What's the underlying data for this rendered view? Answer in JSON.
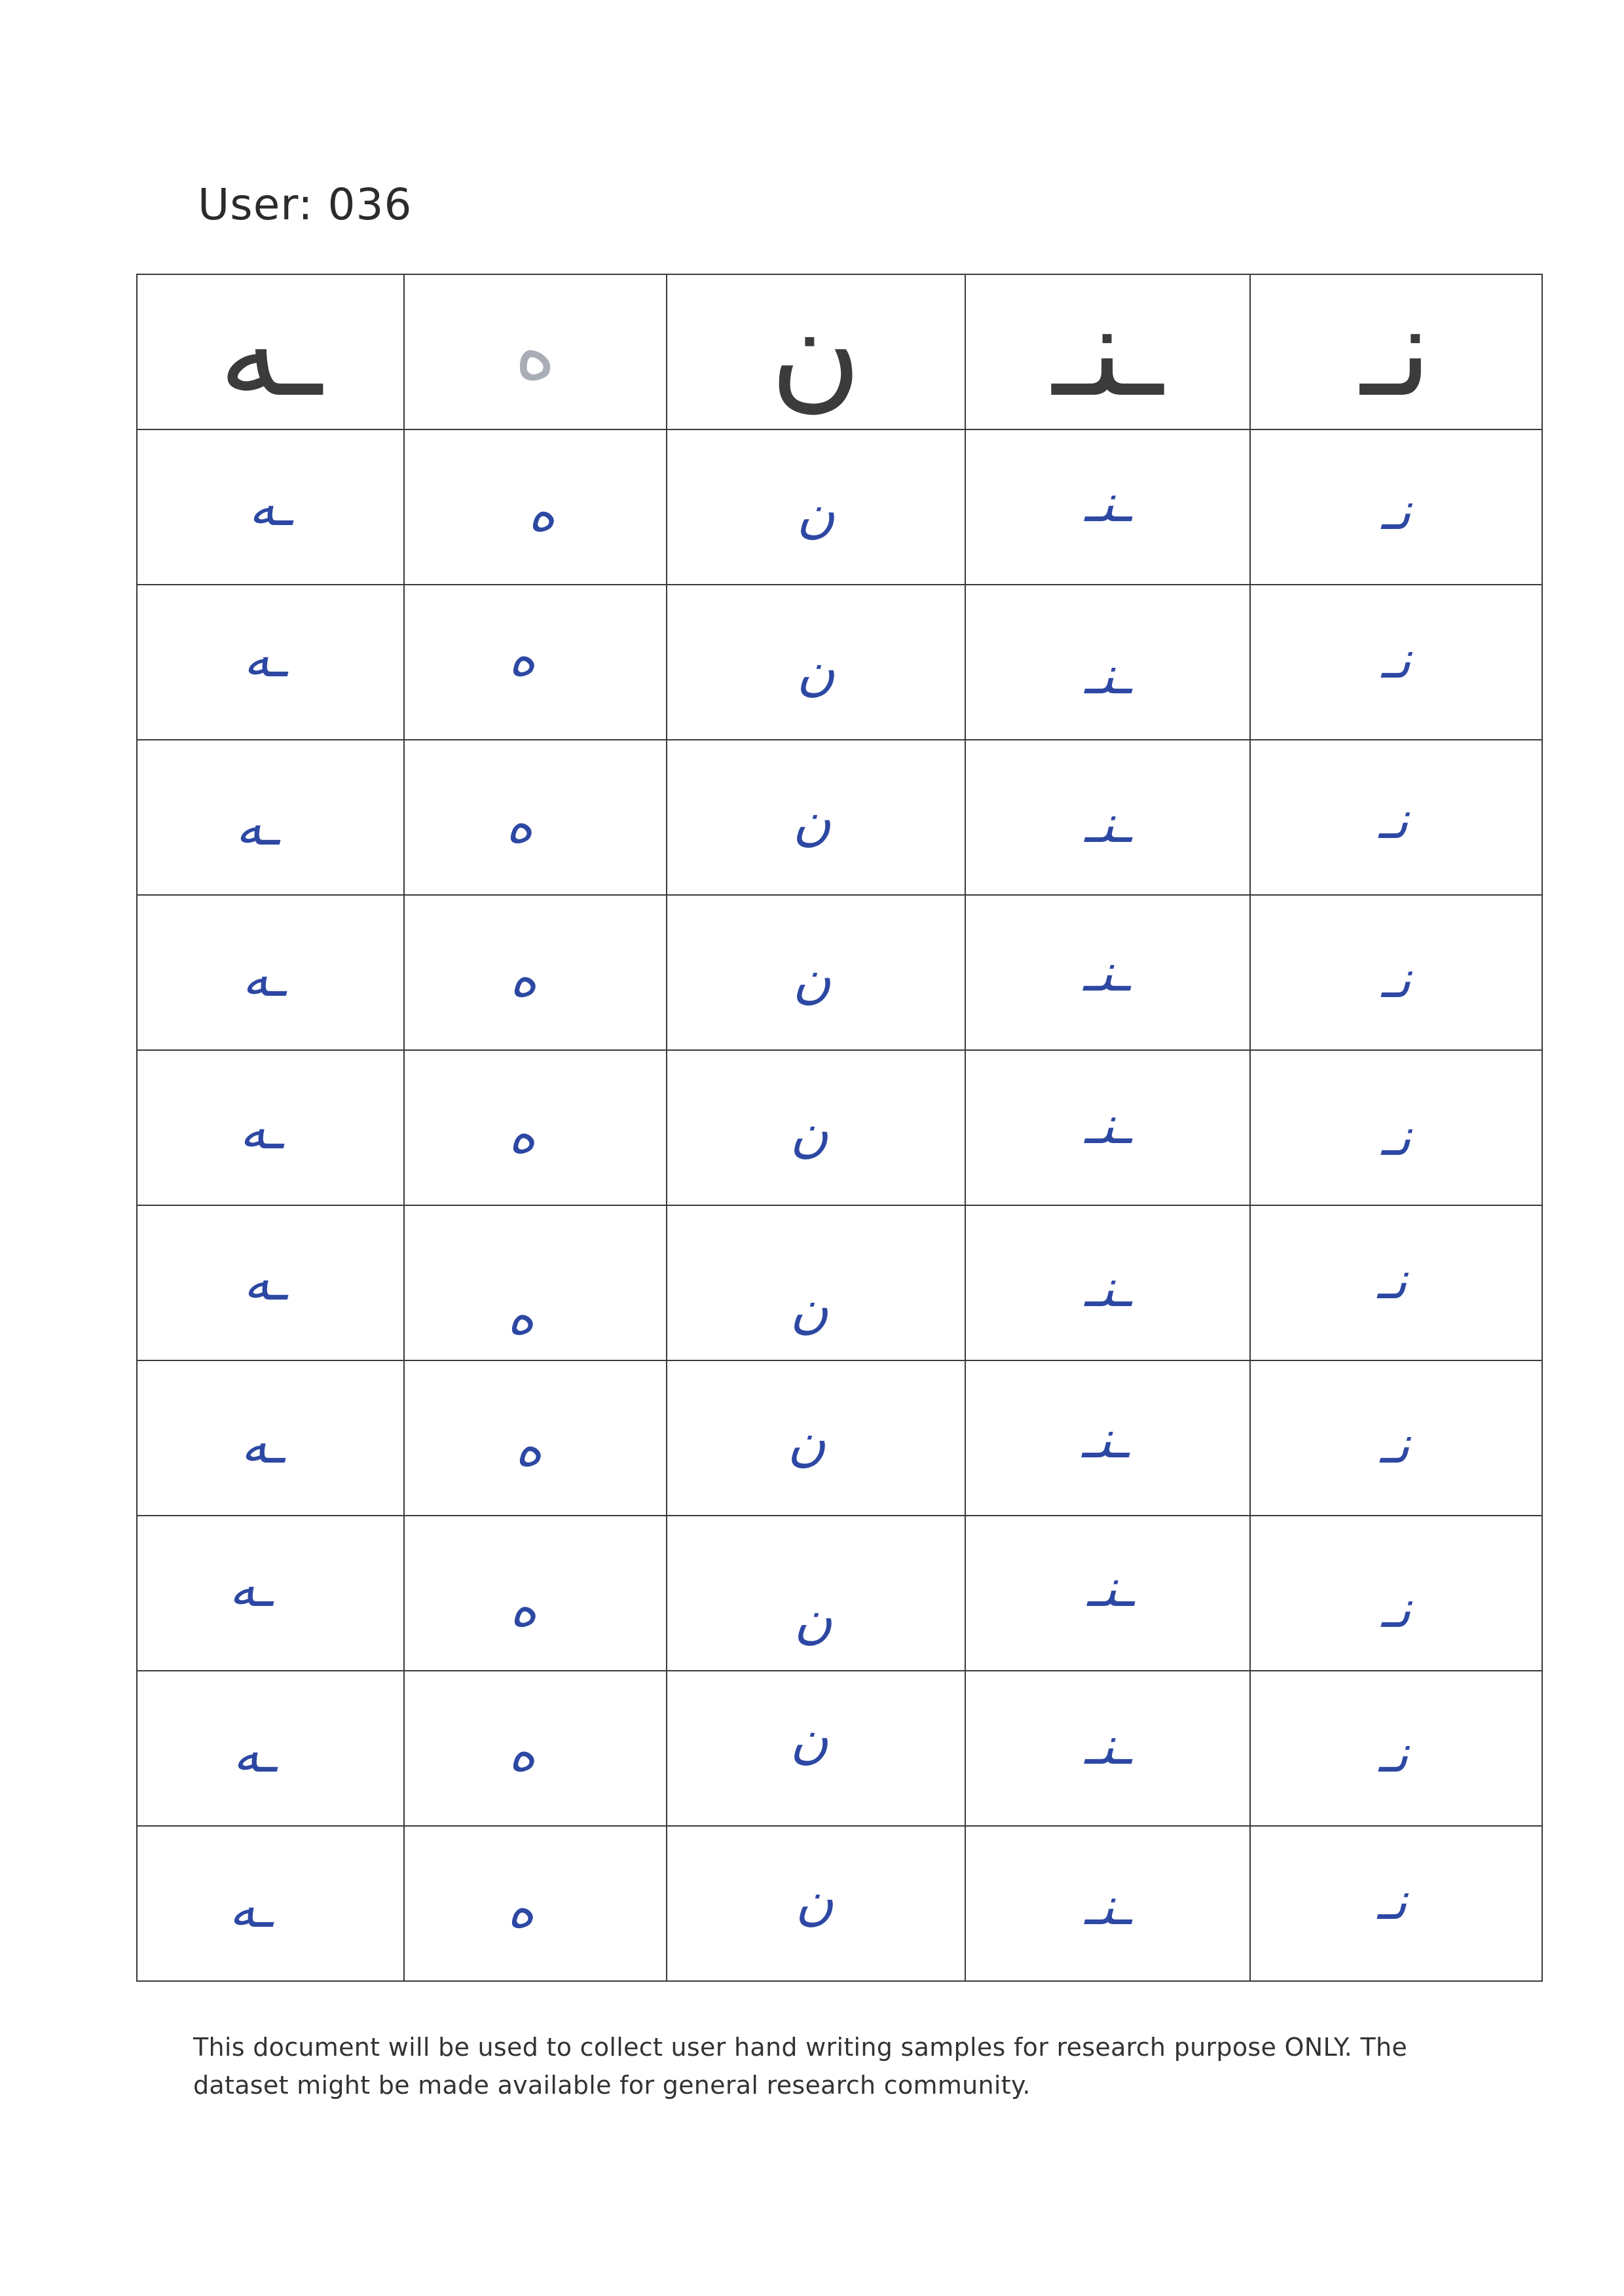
{
  "header": {
    "user_label": "User: 036"
  },
  "grid": {
    "columns": 5,
    "reference_row": [
      "ـه",
      "ه",
      "ن",
      "ـنـ",
      "نـ"
    ],
    "sample_rows": [
      [
        "ـه",
        "ه",
        "ن",
        "ـنـ",
        "نـ"
      ],
      [
        "ـه",
        "ه",
        "ن",
        "ـنـ",
        "نـ"
      ],
      [
        "ـه",
        "ه",
        "ن",
        "ـنـ",
        "نـ"
      ],
      [
        "ـه",
        "ه",
        "ن",
        "ـنـ",
        "نـ"
      ],
      [
        "ـه",
        "ه",
        "ن",
        "ـنـ",
        "نـ"
      ],
      [
        "ـه",
        "ه",
        "ن",
        "ـنـ",
        "نـ"
      ],
      [
        "ـه",
        "ه",
        "ن",
        "ـنـ",
        "نـ"
      ],
      [
        "ـه",
        "ه",
        "ن",
        "ـنـ",
        "نـ"
      ],
      [
        "ـه",
        "ه",
        "ن",
        "ـنـ",
        "نـ"
      ],
      [
        "ـه",
        "ه",
        "ن",
        "ـنـ",
        "نـ"
      ]
    ],
    "reference_color": "#3b3b3b",
    "reference_light_color": "#a9adb6",
    "ink_color": "#2d48a3"
  },
  "footer": {
    "disclaimer": "This document will be used to collect user hand writing samples for research purpose ONLY. The dataset might be made available for general research community."
  }
}
